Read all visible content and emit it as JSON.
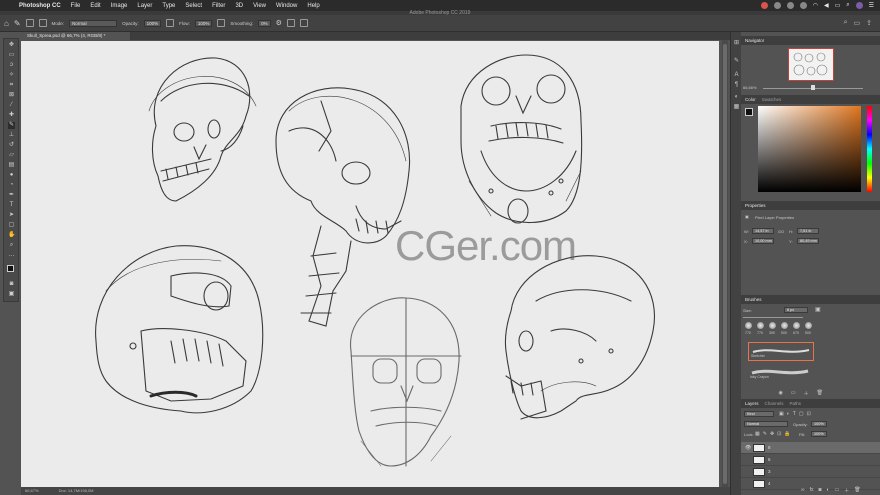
{
  "menubar": {
    "app_name": "Photoshop CC",
    "items": [
      "File",
      "Edit",
      "Image",
      "Layer",
      "Type",
      "Select",
      "Filter",
      "3D",
      "View",
      "Window",
      "Help"
    ],
    "apple_icon": "apple-icon"
  },
  "window": {
    "title": "Adobe Photoshop CC 2019"
  },
  "options": {
    "mode_label": "Mode:",
    "mode_value": "Normal",
    "opacity_label": "Opacity:",
    "opacity_value": "100%",
    "flow_label": "Flow:",
    "flow_value": "100%",
    "smoothing_label": "Smoothing:",
    "smoothing_value": "0%"
  },
  "document": {
    "tab_label": "Skull_Sprea.psd @ 66,7% (4, RGB/8) *",
    "zoom_status": "66,67%",
    "doc_status": "Doc: 14,7M/198,0M"
  },
  "watermark": "CGer.com",
  "panels": {
    "navigator": {
      "tab": "Navigator",
      "zoom": "66,66%"
    },
    "color": {
      "tab": "Color",
      "tab2": "Swatches"
    },
    "properties": {
      "tab": "Properties",
      "subtitle": "Pixel Layer Properties",
      "w_label": "W:",
      "w_value": "14,57 in",
      "h_label": "H:",
      "h_value": "7,51 in",
      "link_label": "GO",
      "x_label": "X:",
      "x_value": "10,00 mm",
      "y_label": "Y:",
      "y_value": "80,49 mm"
    },
    "brushes": {
      "tab": "Brushes",
      "size_label": "Size:",
      "size_value": "8 px",
      "sizes": [
        "770",
        "770",
        "390",
        "500",
        "670",
        "500"
      ],
      "brush1": "Sketcher",
      "brush2": "Inky Crayon"
    },
    "layers": {
      "tabs": [
        "Layers",
        "Channels",
        "Paths"
      ],
      "kind_label": "Kind",
      "blend": "Normal",
      "opacity_label": "Opacity:",
      "opacity_value": "100%",
      "lock_label": "Lock:",
      "fill_label": "Fill:",
      "fill_value": "100%",
      "rows": [
        {
          "name": "8"
        },
        {
          "name": "6"
        },
        {
          "name": "3"
        },
        {
          "name": "4"
        }
      ]
    }
  },
  "colors": {
    "menubar_bg": "#2b2b2b",
    "panel_bg": "#535353",
    "canvas_bg": "#ebebeb",
    "selected_brush_border": "#e8734a"
  }
}
